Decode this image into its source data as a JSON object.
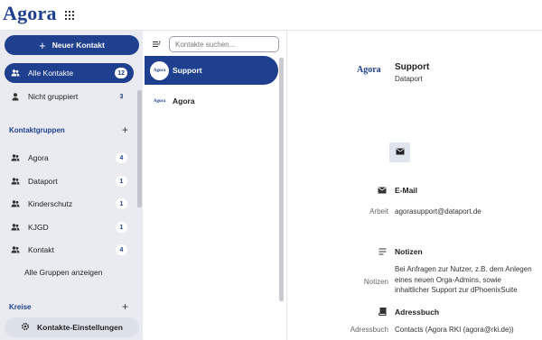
{
  "app": {
    "logo": "Agora"
  },
  "sidebar": {
    "new_contact_label": "Neuer Kontakt",
    "items": [
      {
        "label": "Alle Kontakte",
        "count": "12"
      },
      {
        "label": "Nicht gruppiert",
        "count": "3"
      }
    ],
    "groups_header": "Kontaktgruppen",
    "groups": [
      {
        "label": "Agora",
        "count": "4"
      },
      {
        "label": "Dataport",
        "count": "1"
      },
      {
        "label": "Kinderschutz",
        "count": "1"
      },
      {
        "label": "KJGD",
        "count": "1"
      },
      {
        "label": "Kontakt",
        "count": "4"
      }
    ],
    "show_all_groups": "Alle Gruppen anzeigen",
    "circles_header": "Kreise",
    "settings_label": "Kontakte-Einstellungen"
  },
  "list": {
    "search_placeholder": "Kontakte suchen...",
    "contacts": [
      {
        "name": "Support",
        "avatar_text": "Agora"
      },
      {
        "name": "Agora",
        "avatar_text": "Agora"
      }
    ]
  },
  "detail": {
    "logo_text": "Agora",
    "name": "Support",
    "organization": "Dataport",
    "email_section": "E-Mail",
    "email_label": "Arbeit",
    "email_value": "agorasupport@dataport.de",
    "notes_section": "Notizen",
    "notes_label": "Notizen",
    "notes_value": "Bei Anfragen zur Nutzer, z.B. dem Anlegen eines neuen Orga-Admins, sowie inhaltlicher Support zur dPhoenixSuite",
    "address_section": "Adressbuch",
    "address_label": "Adressbuch",
    "address_value": "Contacts (Agora RKI (agora@rki.de))"
  },
  "colors": {
    "brand": "#1f3f8f",
    "sidebar_bg": "#e9ebf0"
  }
}
